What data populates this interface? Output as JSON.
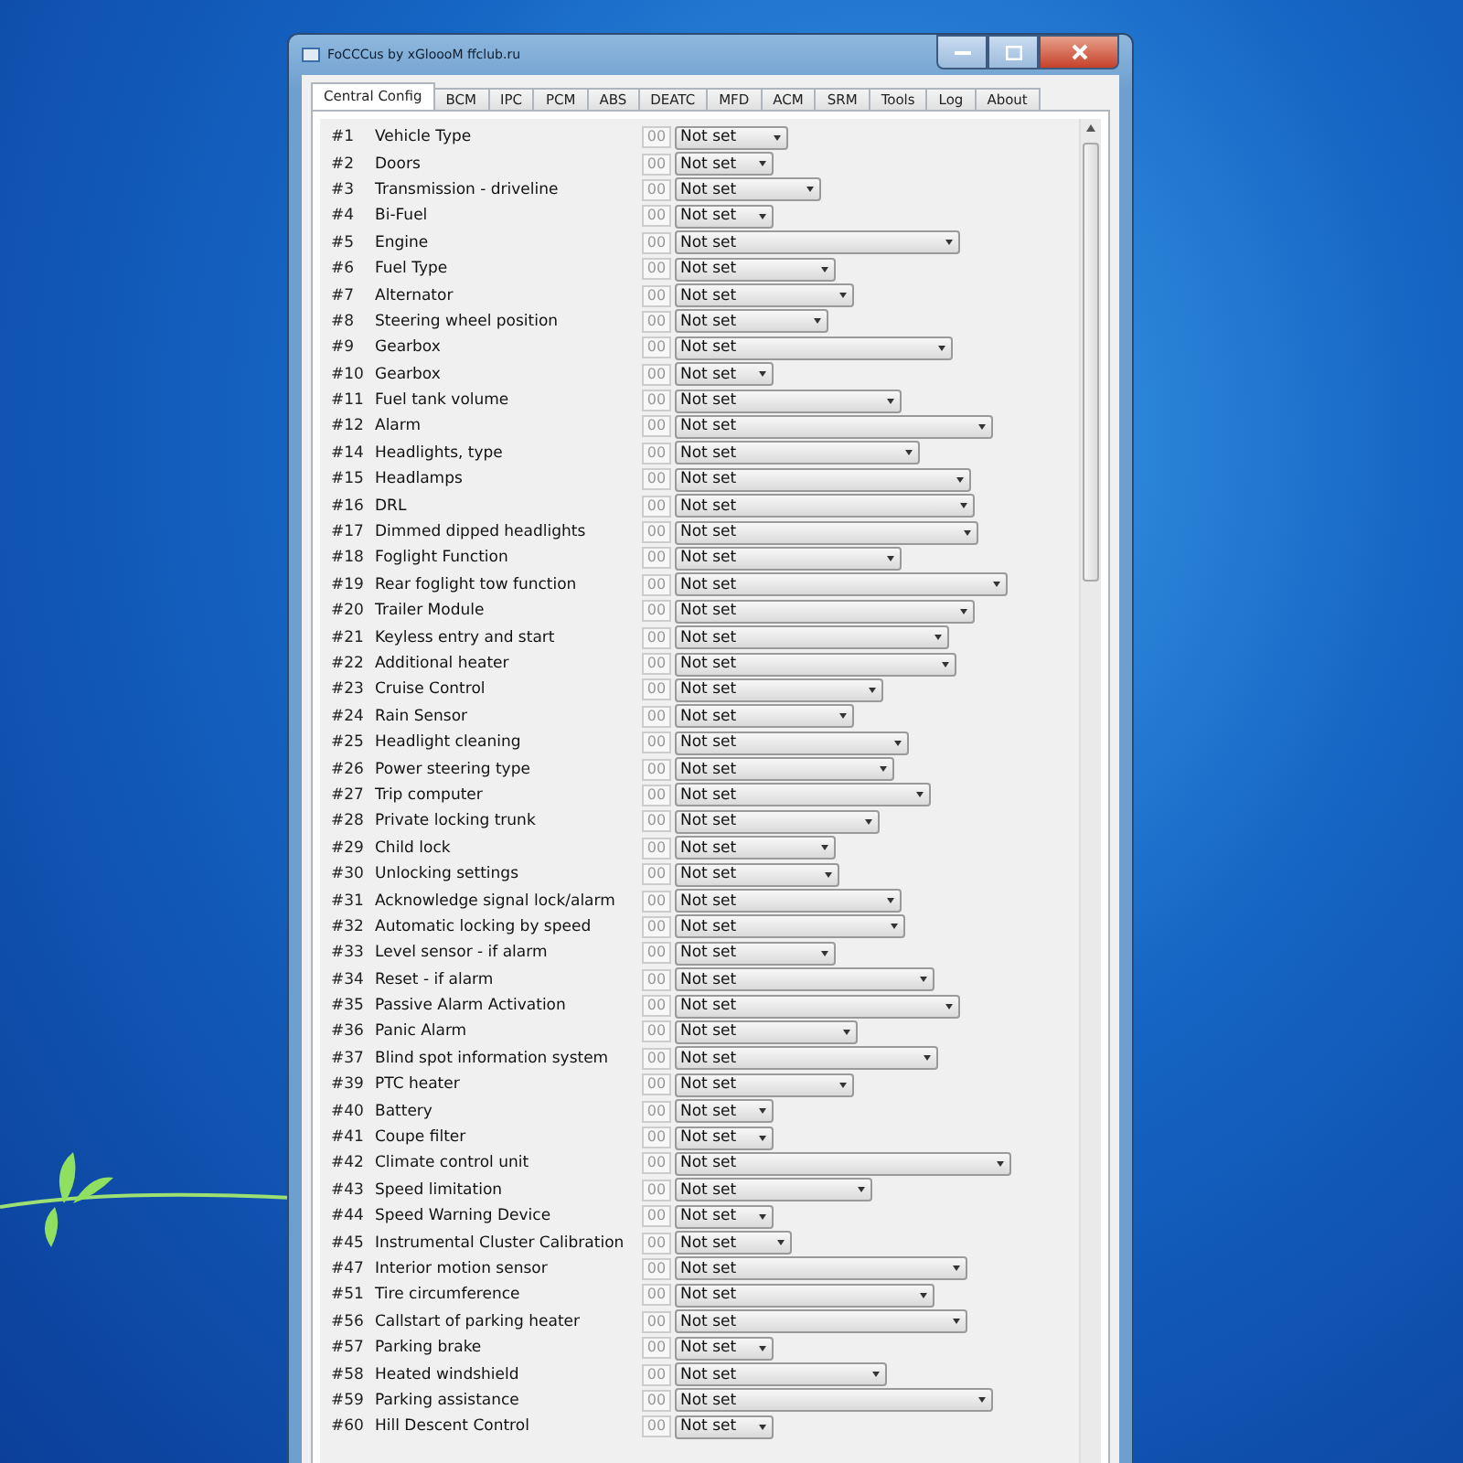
{
  "window": {
    "title": "FoCCCus by xGloooM ffclub.ru"
  },
  "tabs": [
    {
      "label": "Central Config",
      "selected": true
    },
    {
      "label": "BCM",
      "selected": false
    },
    {
      "label": "IPC",
      "selected": false
    },
    {
      "label": "PCM",
      "selected": false
    },
    {
      "label": "ABS",
      "selected": false
    },
    {
      "label": "DEATC",
      "selected": false
    },
    {
      "label": "MFD",
      "selected": false
    },
    {
      "label": "ACM",
      "selected": false
    },
    {
      "label": "SRM",
      "selected": false
    },
    {
      "label": "Tools",
      "selected": false
    },
    {
      "label": "Log",
      "selected": false
    },
    {
      "label": "About",
      "selected": false
    }
  ],
  "rows": [
    {
      "num": "#1",
      "label": "Vehicle Type",
      "code": "00",
      "value": "Not set"
    },
    {
      "num": "#2",
      "label": "Doors",
      "code": "00",
      "value": "Not set"
    },
    {
      "num": "#3",
      "label": "Transmission - driveline",
      "code": "00",
      "value": "Not set"
    },
    {
      "num": "#4",
      "label": "Bi-Fuel",
      "code": "00",
      "value": "Not set"
    },
    {
      "num": "#5",
      "label": "Engine",
      "code": "00",
      "value": "Not set"
    },
    {
      "num": "#6",
      "label": "Fuel Type",
      "code": "00",
      "value": "Not set"
    },
    {
      "num": "#7",
      "label": "Alternator",
      "code": "00",
      "value": "Not set"
    },
    {
      "num": "#8",
      "label": "Steering wheel position",
      "code": "00",
      "value": "Not set"
    },
    {
      "num": "#9",
      "label": "Gearbox",
      "code": "00",
      "value": "Not set"
    },
    {
      "num": "#10",
      "label": "Gearbox",
      "code": "00",
      "value": "Not set"
    },
    {
      "num": "#11",
      "label": "Fuel tank volume",
      "code": "00",
      "value": "Not set"
    },
    {
      "num": "#12",
      "label": "Alarm",
      "code": "00",
      "value": "Not set"
    },
    {
      "num": "#14",
      "label": "Headlights, type",
      "code": "00",
      "value": "Not set"
    },
    {
      "num": "#15",
      "label": "Headlamps",
      "code": "00",
      "value": "Not set"
    },
    {
      "num": "#16",
      "label": "DRL",
      "code": "00",
      "value": "Not set"
    },
    {
      "num": "#17",
      "label": "Dimmed dipped headlights",
      "code": "00",
      "value": "Not set"
    },
    {
      "num": "#18",
      "label": "Foglight Function",
      "code": "00",
      "value": "Not set"
    },
    {
      "num": "#19",
      "label": "Rear foglight tow function",
      "code": "00",
      "value": "Not set"
    },
    {
      "num": "#20",
      "label": "Trailer Module",
      "code": "00",
      "value": "Not set"
    },
    {
      "num": "#21",
      "label": "Keyless entry and start",
      "code": "00",
      "value": "Not set"
    },
    {
      "num": "#22",
      "label": "Additional heater",
      "code": "00",
      "value": "Not set"
    },
    {
      "num": "#23",
      "label": "Cruise Control",
      "code": "00",
      "value": "Not set"
    },
    {
      "num": "#24",
      "label": "Rain Sensor",
      "code": "00",
      "value": "Not set"
    },
    {
      "num": "#25",
      "label": "Headlight cleaning",
      "code": "00",
      "value": "Not set"
    },
    {
      "num": "#26",
      "label": "Power steering type",
      "code": "00",
      "value": "Not set"
    },
    {
      "num": "#27",
      "label": "Trip computer",
      "code": "00",
      "value": "Not set"
    },
    {
      "num": "#28",
      "label": "Private locking trunk",
      "code": "00",
      "value": "Not set"
    },
    {
      "num": "#29",
      "label": "Child lock",
      "code": "00",
      "value": "Not set"
    },
    {
      "num": "#30",
      "label": "Unlocking settings",
      "code": "00",
      "value": "Not set"
    },
    {
      "num": "#31",
      "label": "Acknowledge signal lock/alarm",
      "code": "00",
      "value": "Not set"
    },
    {
      "num": "#32",
      "label": "Automatic locking by speed",
      "code": "00",
      "value": "Not set"
    },
    {
      "num": "#33",
      "label": "Level sensor - if alarm",
      "code": "00",
      "value": "Not set"
    },
    {
      "num": "#34",
      "label": "Reset - if alarm",
      "code": "00",
      "value": "Not set"
    },
    {
      "num": "#35",
      "label": "Passive Alarm Activation",
      "code": "00",
      "value": "Not set"
    },
    {
      "num": "#36",
      "label": "Panic Alarm",
      "code": "00",
      "value": "Not set"
    },
    {
      "num": "#37",
      "label": "Blind spot information system",
      "code": "00",
      "value": "Not set"
    },
    {
      "num": "#39",
      "label": "PTC heater",
      "code": "00",
      "value": "Not set"
    },
    {
      "num": "#40",
      "label": "Battery",
      "code": "00",
      "value": "Not set"
    },
    {
      "num": "#41",
      "label": "Coupe filter",
      "code": "00",
      "value": "Not set"
    },
    {
      "num": "#42",
      "label": "Climate control unit",
      "code": "00",
      "value": "Not set"
    },
    {
      "num": "#43",
      "label": "Speed limitation",
      "code": "00",
      "value": "Not set"
    },
    {
      "num": "#44",
      "label": "Speed Warning Device",
      "code": "00",
      "value": "Not set"
    },
    {
      "num": "#45",
      "label": "Instrumental Cluster Calibration",
      "code": "00",
      "value": "Not set"
    },
    {
      "num": "#47",
      "label": "Interior motion sensor",
      "code": "00",
      "value": "Not set"
    },
    {
      "num": "#51",
      "label": "Tire circumference",
      "code": "00",
      "value": "Not set"
    },
    {
      "num": "#56",
      "label": "Callstart of parking heater",
      "code": "00",
      "value": "Not set"
    },
    {
      "num": "#57",
      "label": "Parking brake",
      "code": "00",
      "value": "Not set"
    },
    {
      "num": "#58",
      "label": "Heated windshield",
      "code": "00",
      "value": "Not set"
    },
    {
      "num": "#59",
      "label": "Parking assistance",
      "code": "00",
      "value": "Not set"
    },
    {
      "num": "#60",
      "label": "Hill Descent Control",
      "code": "00",
      "value": "Not set"
    }
  ]
}
